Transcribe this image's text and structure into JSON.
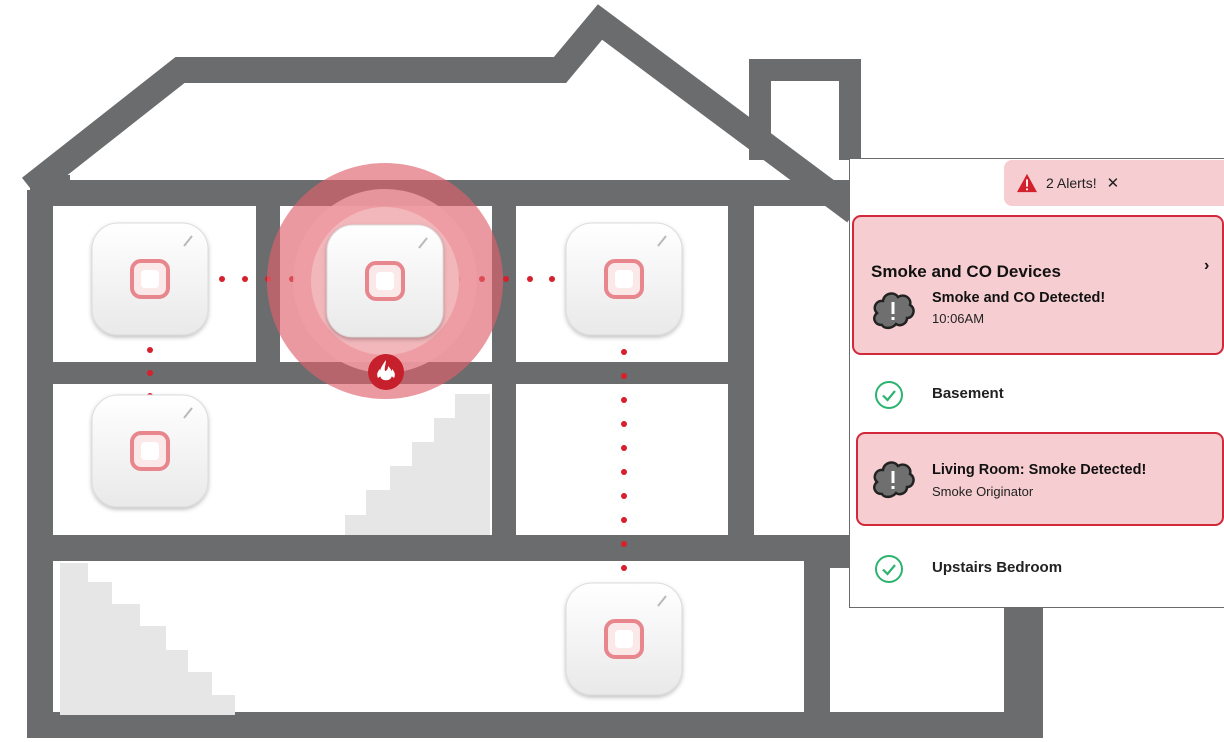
{
  "alerts_badge": {
    "label": "2 Alerts!",
    "close_glyph": "✕"
  },
  "device_group": {
    "title": "Smoke and CO Devices",
    "chevron": "›",
    "event_title": "Smoke and CO Detected!",
    "event_time": "10:06AM"
  },
  "rooms": [
    {
      "name": "Basement",
      "status": "ok"
    },
    {
      "name": "Living Room: Smoke Detected!",
      "subtitle": "Smoke Originator",
      "status": "alert"
    },
    {
      "name": "Upstairs Bedroom",
      "status": "ok"
    }
  ],
  "colors": {
    "house_outline": "#6b6c6e",
    "alert_fill": "#f6cdd0",
    "alert_border": "#d2293a",
    "ok_green": "#2bb36f",
    "detector_ring": "#e8868e",
    "dotted_link": "#d6202c"
  },
  "icons": {
    "warning": "warning-triangle-icon",
    "smoke": "smoke-cloud-icon",
    "check": "check-circle-icon",
    "fire": "flame-icon"
  }
}
